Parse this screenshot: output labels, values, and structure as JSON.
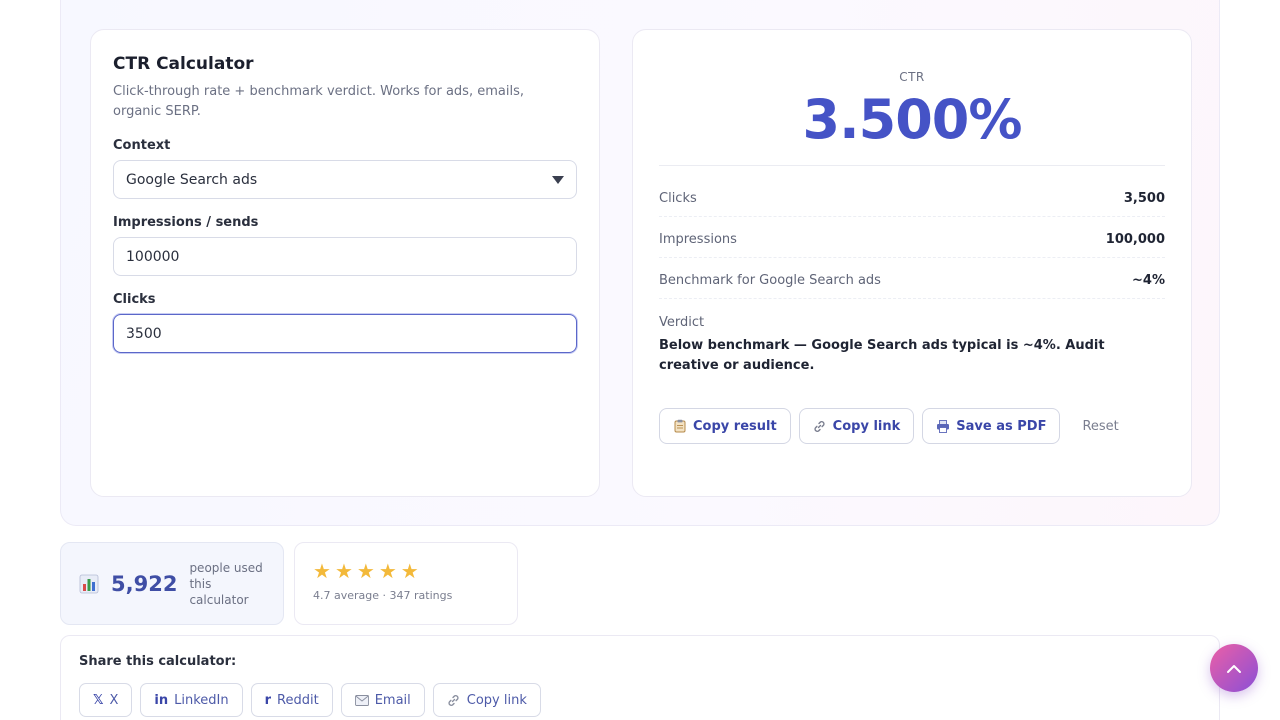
{
  "calculator": {
    "title": "CTR Calculator",
    "subtitle": "Click-through rate + benchmark verdict. Works for ads, emails, organic SERP.",
    "context_label": "Context",
    "context_value": "Google Search ads",
    "impressions_label": "Impressions / sends",
    "impressions_value": "100000",
    "clicks_label": "Clicks",
    "clicks_value": "3500"
  },
  "result": {
    "metric_label": "CTR",
    "metric_value": "3.500%",
    "rows": [
      {
        "key": "Clicks",
        "value": "3,500"
      },
      {
        "key": "Impressions",
        "value": "100,000"
      },
      {
        "key": "Benchmark for Google Search ads",
        "value": "~4%"
      }
    ],
    "verdict_label": "Verdict",
    "verdict_text": "Below benchmark — Google Search ads typical is ~4%. Audit creative or audience.",
    "buttons": {
      "copy_result": "Copy result",
      "copy_link": "Copy link",
      "save_pdf": "Save as PDF",
      "reset": "Reset"
    }
  },
  "stats": {
    "users_count": "5,922",
    "users_desc": "people used this calculator",
    "rating_stars": 5,
    "rating_text": "4.7 average · 347 ratings"
  },
  "share": {
    "title": "Share this calculator:",
    "buttons": {
      "x": "X",
      "linkedin": "LinkedIn",
      "reddit": "Reddit",
      "email": "Email",
      "copy_link": "Copy link"
    }
  },
  "colors": {
    "accent": "#4553c6",
    "star": "#f3b93a"
  }
}
